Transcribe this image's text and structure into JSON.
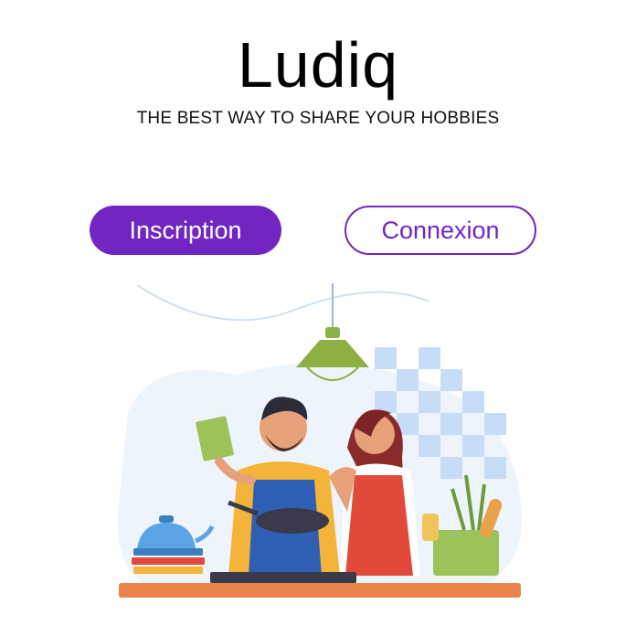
{
  "app": {
    "title": "Ludiq",
    "tagline": "THE BEST WAY TO SHARE YOUR HOBBIES"
  },
  "buttons": {
    "signup_label": "Inscription",
    "login_label": "Connexion"
  },
  "colors": {
    "accent": "#7126c2",
    "background": "#ffffff"
  },
  "illustration": {
    "icon": "cooking-couple-illustration"
  }
}
